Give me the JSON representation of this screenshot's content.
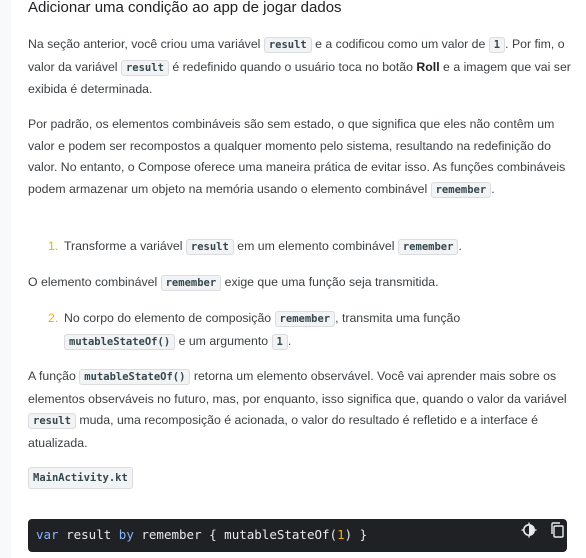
{
  "section": {
    "title": "Adicionar uma condição ao app de jogar dados"
  },
  "p1": {
    "t1": "Na seção anterior, você criou uma variável ",
    "c1": "result",
    "t2": " e a codificou como um valor de ",
    "c2": "1",
    "t3": ". Por fim, o valor da variável ",
    "c3": "result",
    "t4": " é redefinido quando o usuário toca no botão ",
    "b1": "Roll",
    "t5": " e a imagem que vai ser exibida é determinada."
  },
  "p2": {
    "t1": "Por padrão, os elementos combináveis são sem estado, o que significa que eles não contêm um valor e podem ser recompostos a qualquer momento pelo sistema, resultando na redefinição do valor. No entanto, o Compose oferece uma maneira prática de evitar isso. As funções combináveis podem armazenar um objeto na memória usando o elemento combinável ",
    "c1": "remember",
    "t2": "."
  },
  "step1": {
    "num": "1.",
    "t1": "Transforme a variável ",
    "c1": "result",
    "t2": " em um elemento combinável ",
    "c2": "remember",
    "t3": "."
  },
  "p3": {
    "t1": "O elemento combinável ",
    "c1": "remember",
    "t2": " exige que uma função seja transmitida."
  },
  "step2": {
    "num": "2.",
    "t1": "No corpo do elemento de composição ",
    "c1": "remember",
    "t2": ", transmita uma função ",
    "c2": "mutableStateOf()",
    "t3": " e um argumento ",
    "c3": "1",
    "t4": "."
  },
  "p4": {
    "t1": "A função ",
    "c1": "mutableStateOf()",
    "t2": " retorna um elemento observável. Você vai aprender mais sobre os elementos observáveis no futuro, mas, por enquanto, isso significa que, quando o valor da variável ",
    "c2": "result",
    "t3": " muda, uma recomposição é acionada, o valor do resultado é refletido e a interface é atualizada."
  },
  "file_label": "MainActivity.kt",
  "code": {
    "kw_var": "var",
    "name": " result ",
    "kw_by": "by",
    "rest1": " remember { mutableStateOf(",
    "arg": "1",
    "rest2": ") }",
    "tools": {
      "theme_icon": "brightness-icon",
      "copy_icon": "copy-icon"
    }
  }
}
